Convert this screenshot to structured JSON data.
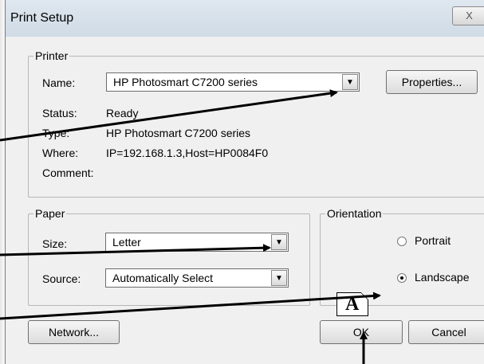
{
  "window": {
    "title": "Print Setup",
    "close_glyph": "X"
  },
  "printer": {
    "legend": "Printer",
    "name_label": "Name:",
    "name_value": "HP Photosmart C7200 series",
    "properties_label": "Properties...",
    "status_label": "Status:",
    "status_value": "Ready",
    "type_label": "Type:",
    "type_value": "HP Photosmart C7200 series",
    "where_label": "Where:",
    "where_value": "IP=192.168.1.3,Host=HP0084F0",
    "comment_label": "Comment:",
    "comment_value": ""
  },
  "paper": {
    "legend": "Paper",
    "size_label": "Size:",
    "size_value": "Letter",
    "source_label": "Source:",
    "source_value": "Automatically Select"
  },
  "orientation": {
    "legend": "Orientation",
    "icon_glyph": "A",
    "options": [
      {
        "label": "Portrait",
        "checked": false
      },
      {
        "label": "Landscape",
        "checked": true
      }
    ]
  },
  "buttons": {
    "network": "Network...",
    "ok": "OK",
    "cancel": "Cancel"
  },
  "colors": {
    "dialog_bg": "#f0f0f0",
    "titlebar": "#d5e0ea",
    "annotation_arrow": "#000000"
  }
}
